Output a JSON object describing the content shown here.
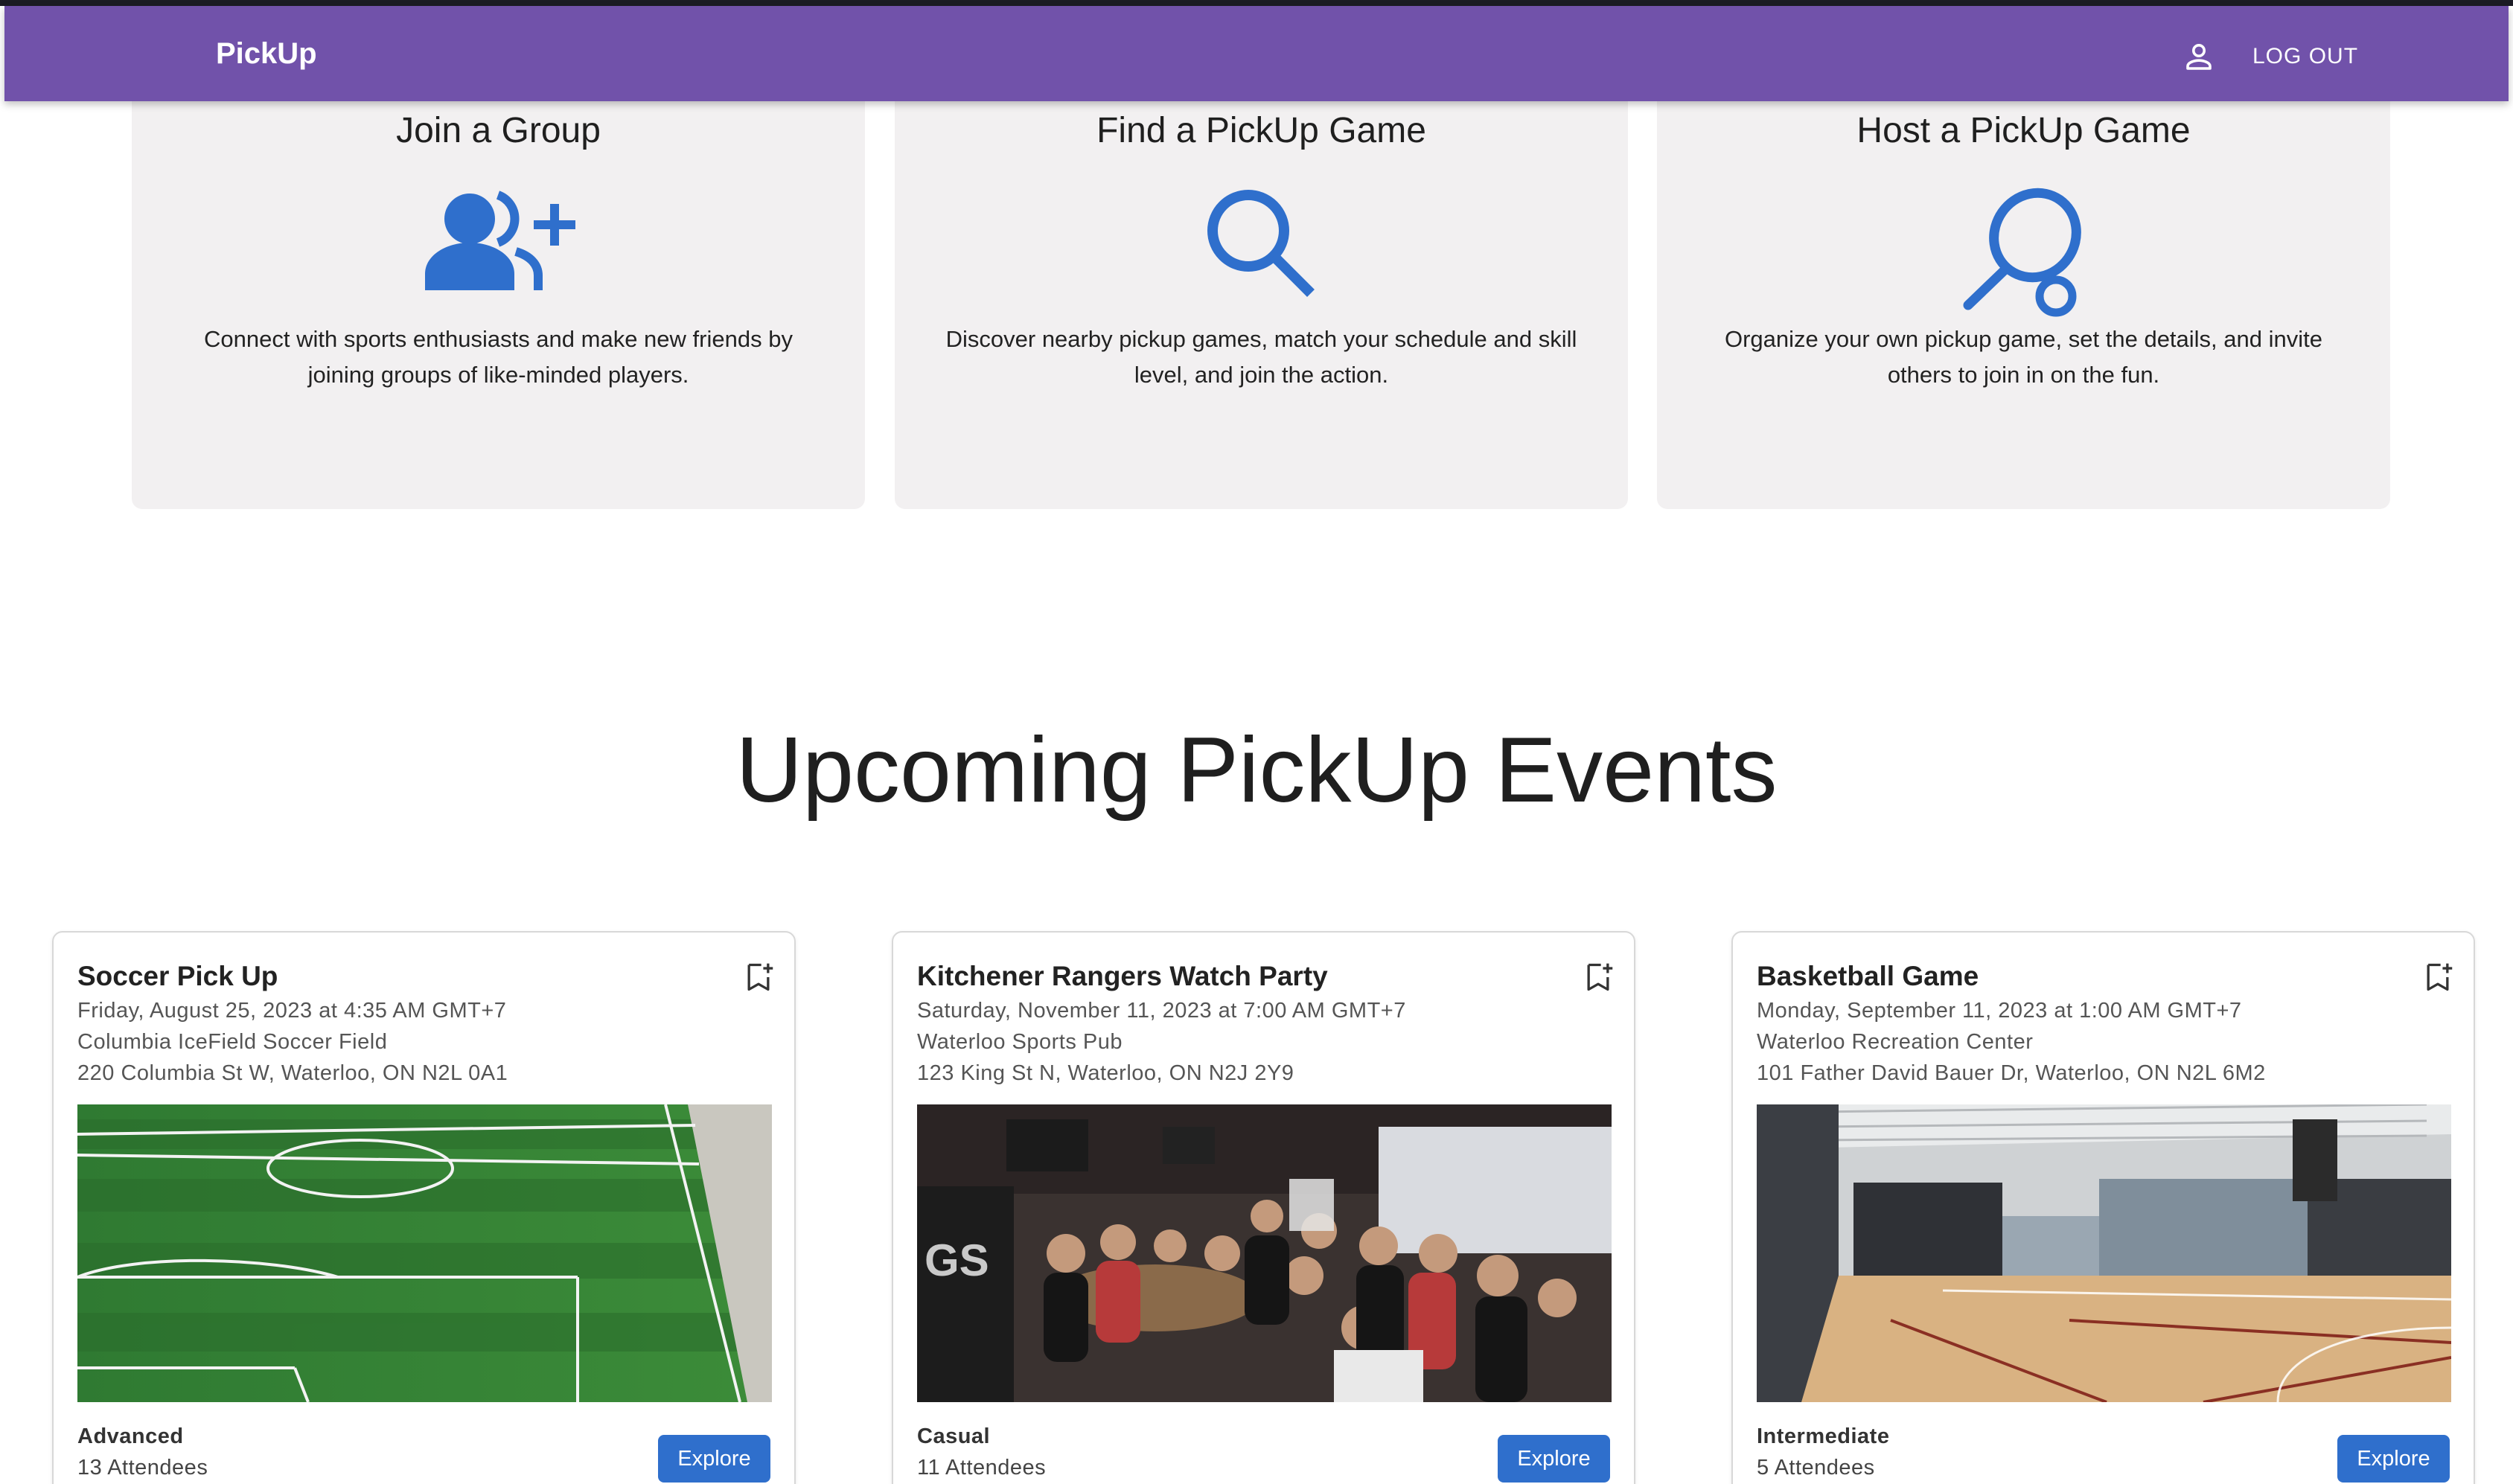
{
  "appbar": {
    "brand": "PickUp",
    "user_icon": "person-outline-icon",
    "logout_label": "LOG OUT",
    "color": "#7152aa"
  },
  "features": [
    {
      "title": "Join a Group",
      "icon": "group-add-icon",
      "description": "Connect with sports enthusiasts and make new friends by joining groups of like-minded players."
    },
    {
      "title": "Find a PickUp Game",
      "icon": "search-icon",
      "description": "Discover nearby pickup games, match your schedule and skill level, and join the action."
    },
    {
      "title": "Host a PickUp Game",
      "icon": "racket-icon",
      "description": "Organize your own pickup game, set the details, and invite others to join in on the fun."
    }
  ],
  "accent": "#2f6fcc",
  "events_section": {
    "title": "Upcoming PickUp Events"
  },
  "events": [
    {
      "title": "Soccer Pick Up",
      "datetime": "Friday, August 25, 2023 at 4:35 AM GMT+7",
      "venue": "Columbia IceField Soccer Field",
      "address": "220 Columbia St W, Waterloo, ON N2L 0A1",
      "level": "Advanced",
      "attendees": "13 Attendees",
      "explore_label": "Explore",
      "image": "soccer-field-photo"
    },
    {
      "title": "Kitchener Rangers Watch Party",
      "datetime": "Saturday, November 11, 2023 at 7:00 AM GMT+7",
      "venue": "Waterloo Sports Pub",
      "address": "123 King St N, Waterloo, ON N2J 2Y9",
      "level": "Casual",
      "attendees": "11 Attendees",
      "explore_label": "Explore",
      "image": "sports-pub-crowd-photo"
    },
    {
      "title": "Basketball Game",
      "datetime": "Monday, September 11, 2023 at 1:00 AM GMT+7",
      "venue": "Waterloo Recreation Center",
      "address": "101 Father David Bauer Dr, Waterloo, ON N2L 6M2",
      "level": "Intermediate",
      "attendees": "5 Attendees",
      "explore_label": "Explore",
      "image": "basketball-gym-photo"
    }
  ]
}
